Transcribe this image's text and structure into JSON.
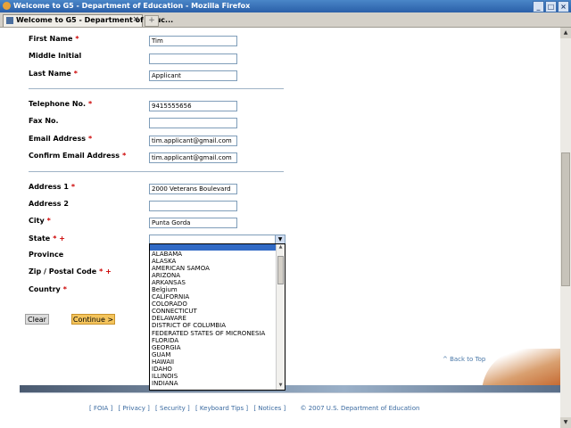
{
  "window": {
    "title": "Welcome to G5 - Department of Education - Mozilla Firefox"
  },
  "tab": {
    "label": "Welcome to G5 - Department of Educ...",
    "new_tab": "+"
  },
  "form": {
    "first_name": {
      "label": "First Name",
      "required": "*",
      "value": "Tim"
    },
    "middle_initial": {
      "label": "Middle Initial",
      "value": ""
    },
    "last_name": {
      "label": "Last Name",
      "required": "*",
      "value": "Applicant"
    },
    "telephone": {
      "label": "Telephone No.",
      "required": "*",
      "value": "9415555656"
    },
    "fax": {
      "label": "Fax No.",
      "value": ""
    },
    "email": {
      "label": "Email Address",
      "required": "*",
      "value": "tim.applicant@gmail.com"
    },
    "confirm_email": {
      "label": "Confirm Email Address",
      "required": "*",
      "value": "tim.applicant@gmail.com"
    },
    "address1": {
      "label": "Address 1",
      "required": "*",
      "value": "2000 Veterans Boulevard"
    },
    "address2": {
      "label": "Address 2",
      "value": ""
    },
    "city": {
      "label": "City",
      "required": "*",
      "value": "Punta Gorda"
    },
    "state": {
      "label": "State",
      "required": "* +",
      "value": ""
    },
    "province": {
      "label": "Province"
    },
    "zip": {
      "label": "Zip / Postal Code",
      "required": "* +"
    },
    "country": {
      "label": "Country",
      "required": "*"
    }
  },
  "state_options": [
    "ALABAMA",
    "ALASKA",
    "AMERICAN SAMOA",
    "ARIZONA",
    "ARKANSAS",
    "Belgium",
    "CALIFORNIA",
    "COLORADO",
    "CONNECTICUT",
    "DELAWARE",
    "DISTRICT OF COLUMBIA",
    "FEDERATED STATES OF MICRONESIA",
    "FLORIDA",
    "GEORGIA",
    "GUAM",
    "HAWAII",
    "IDAHO",
    "ILLINOIS",
    "INDIANA"
  ],
  "buttons": {
    "clear": "Clear",
    "continue": "Continue >"
  },
  "back_to_top": "^ Back to Top",
  "footer": {
    "links": [
      "[ FOIA ]",
      "[ Privacy ]",
      "[ Security ]",
      "[ Keyboard Tips ]",
      "[ Notices ]"
    ],
    "copyright": "© 2007 U.S. Department of Education"
  },
  "colors": {
    "required": "#cc0000",
    "link": "#3a6aa0",
    "continue_button": "#f4c45c"
  }
}
